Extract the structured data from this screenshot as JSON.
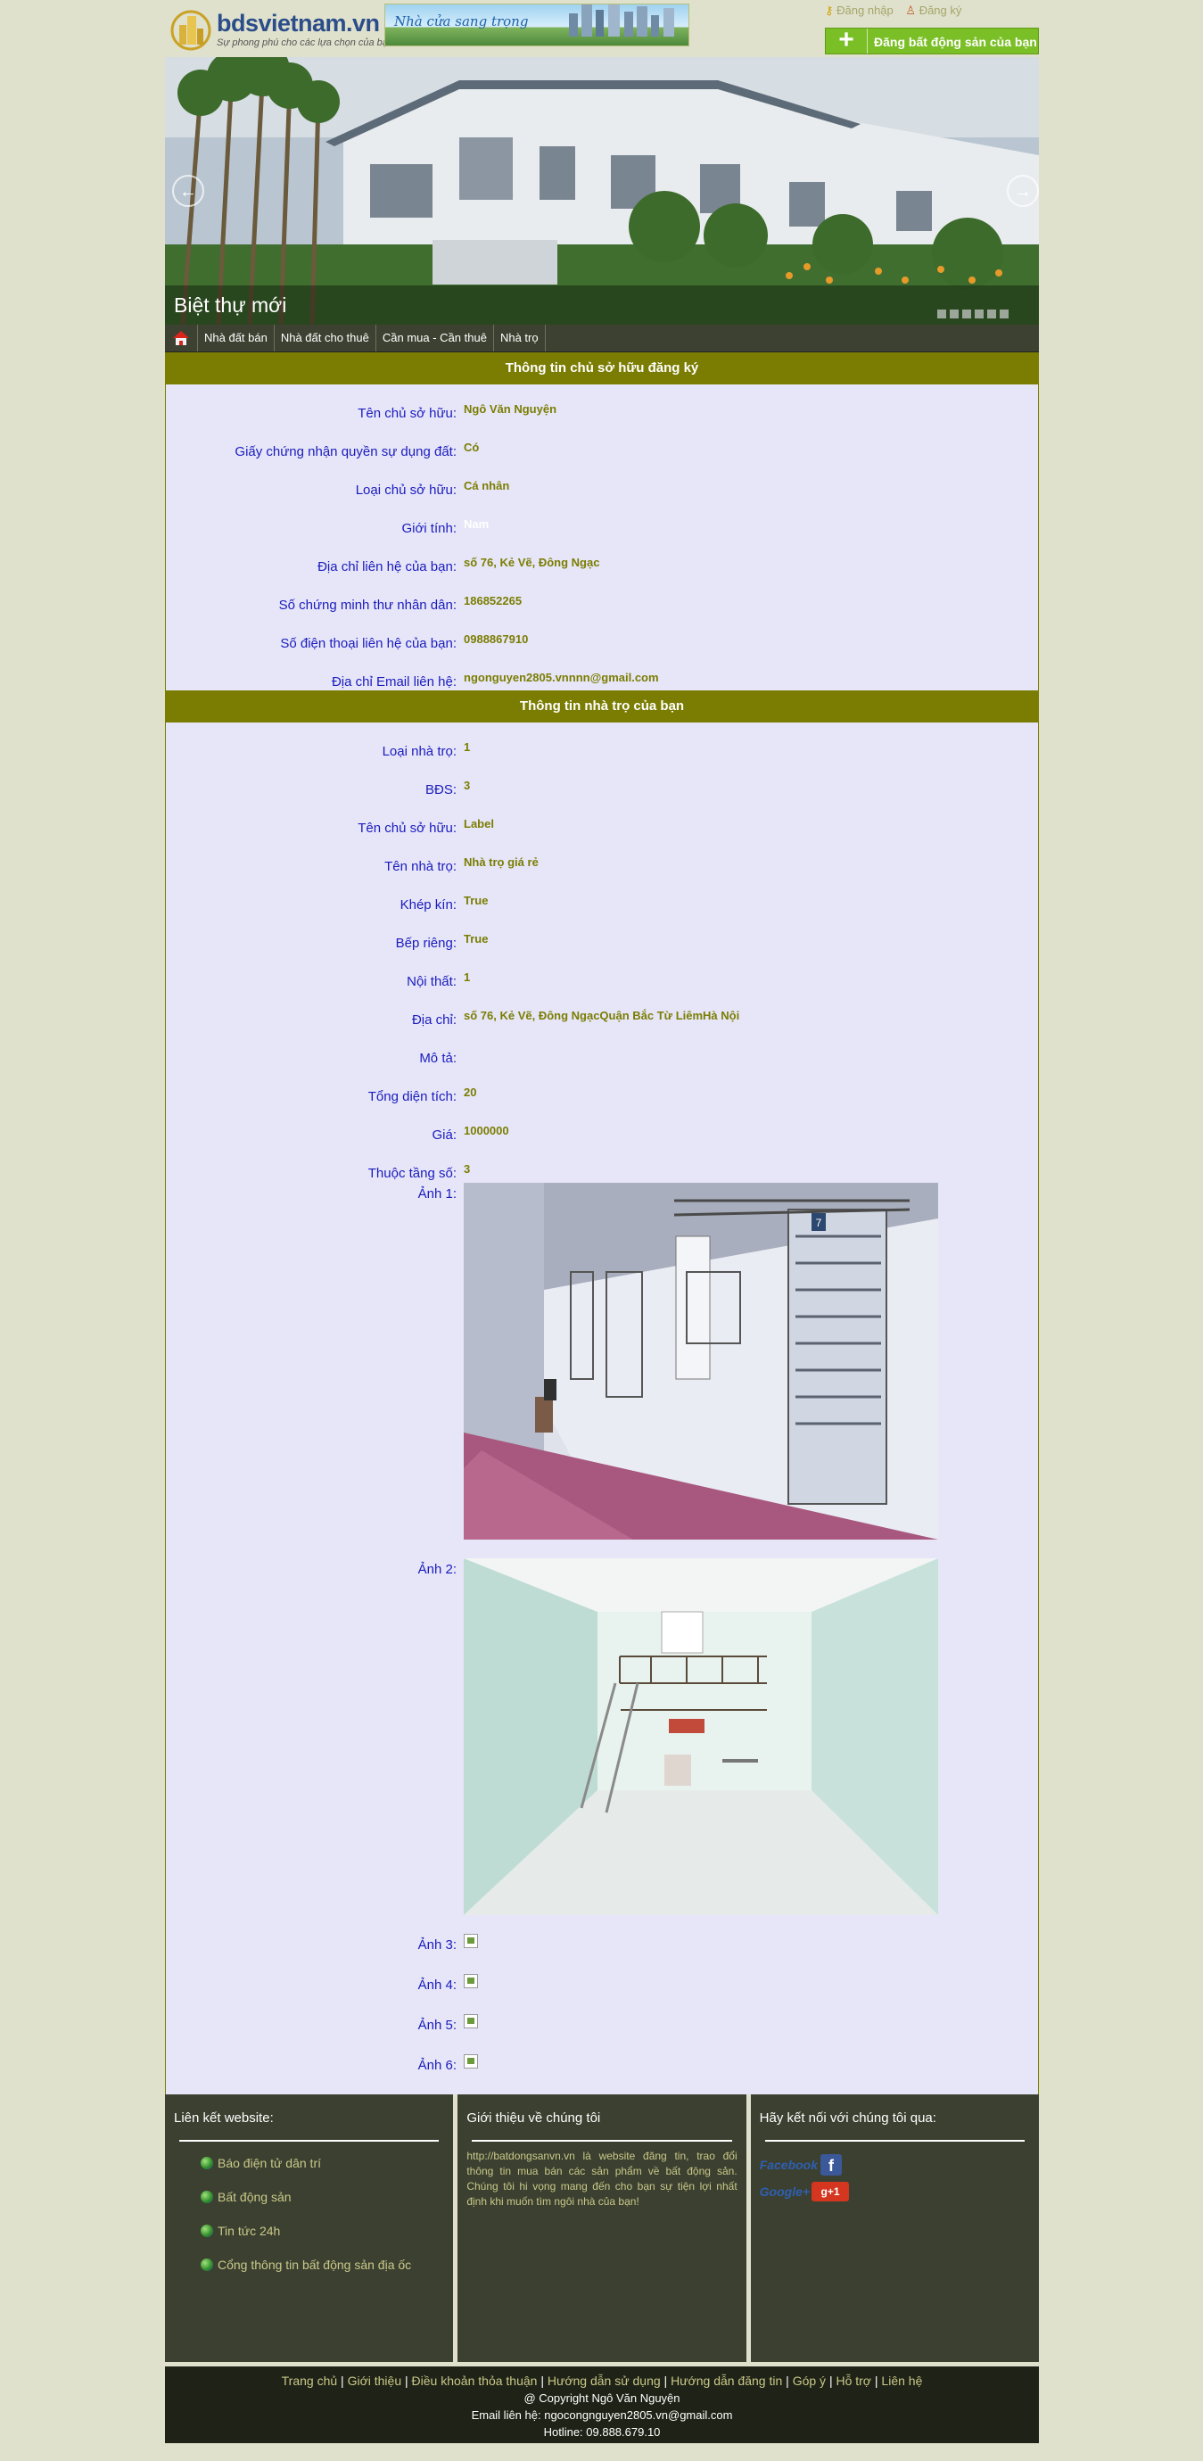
{
  "header": {
    "logo_name": "bdsvietnam.vn",
    "logo_slogan": "Sự phong phú cho các lựa chọn của bạn",
    "banner_text": "Nhà cửa sang trọng",
    "login_label": "Đăng nhập",
    "register_label": "Đăng ký",
    "post_button": "Đăng bất động sản của bạn"
  },
  "slider": {
    "caption": "Biệt thự mới",
    "prev_arrow": "←",
    "next_arrow": "→"
  },
  "nav": {
    "items": [
      "Nhà đất bán",
      "Nhà đất cho thuê",
      "Cần mua - Cần thuê",
      "Nhà trọ"
    ]
  },
  "owner": {
    "title": "Thông tin chủ sở hữu đăng ký",
    "fields": [
      {
        "label": "Tên chủ sở hữu:",
        "value": "Ngô Văn Nguyện"
      },
      {
        "label": "Giấy chứng nhận quyền sự dụng đất:",
        "value": "Có"
      },
      {
        "label": "Loại chủ sở hữu:",
        "value": "Cá nhân"
      },
      {
        "label": "Giới tính:",
        "value": "Nam"
      },
      {
        "label": "Địa chỉ liên hệ của bạn:",
        "value": "số 76, Kẻ Vẽ, Đông Ngạc"
      },
      {
        "label": "Số chứng minh thư nhân dân:",
        "value": "186852265"
      },
      {
        "label": "Số điện thoại liên hệ của bạn:",
        "value": "0988867910"
      },
      {
        "label": "Địa chỉ Email liên hệ:",
        "value": "ngonguyen2805.vnnnn@gmail.com"
      }
    ]
  },
  "house": {
    "title": "Thông tin nhà trọ của bạn",
    "fields": [
      {
        "label": "Loại nhà trọ:",
        "value": "1"
      },
      {
        "label": "BĐS:",
        "value": "3"
      },
      {
        "label": "Tên chủ sở hữu:",
        "value": "Label"
      },
      {
        "label": "Tên nhà trọ:",
        "value": "Nhà trọ giá rẻ"
      },
      {
        "label": "Khép kín:",
        "value": "True"
      },
      {
        "label": "Bếp riêng:",
        "value": "True"
      },
      {
        "label": "Nội thất:",
        "value": "1"
      },
      {
        "label": "Địa chỉ:",
        "value": "số 76, Kẻ Vẽ, Đông NgạcQuận Bắc Từ LiêmHà Nội"
      },
      {
        "label": "Mô tả:",
        "value": ""
      },
      {
        "label": "Tổng diện tích:",
        "value": "20"
      },
      {
        "label": "Giá:",
        "value": "1000000"
      },
      {
        "label": "Thuộc tầng số:",
        "value": "3"
      }
    ],
    "photos": {
      "label1": "Ảnh 1:",
      "label2": "Ảnh 2:",
      "label3": "Ảnh 3:",
      "label4": "Ảnh 4:",
      "label5": "Ảnh 5:",
      "label6": "Ảnh 6:",
      "door_number": "7"
    }
  },
  "footer": {
    "links_title": "Liên kết website:",
    "links": [
      "Báo điện tử dân trí",
      "Bất động sản",
      "Tin tức 24h",
      "Cổng thông tin bất động sản địa ốc"
    ],
    "about_title": "Giới thiệu về chúng tôi",
    "about_text": "http://batdongsanvn.vn là website đăng tin, trao đổi thông tin mua bán các sản phẩm về bất động sản. Chúng tôi hi vọng mang đến cho bạn sự tiện lợi nhất định khi muốn tìm ngôi nhà của bạn!",
    "social_title": "Hãy kết nối với chúng tôi qua:",
    "facebook": "Facebook",
    "facebook_icon": "f",
    "google": "Google+",
    "google_icon": "g+1",
    "bottom_links": [
      "Trang chủ",
      "Giới thiệu",
      "Điều khoản thỏa thuận",
      "Hướng dẫn sử dụng",
      "Hướng dẫn đăng tin",
      "Góp ý",
      "Hỗ trợ",
      "Liên hệ"
    ],
    "separator": "|",
    "copyright": "@ Copyright Ngô Văn Nguyện",
    "contact": "Email liên hệ: ngocongnguyen2805.vn@gmail.com",
    "hotline": "Hotline: 09.888.679.10"
  },
  "colors": {
    "accent": "#7b7d02",
    "label_blue": "#1b1bbf",
    "panel_bg": "#e6e6f8",
    "page_bg": "#dfe1cc",
    "footer_dark": "#3c4030"
  }
}
